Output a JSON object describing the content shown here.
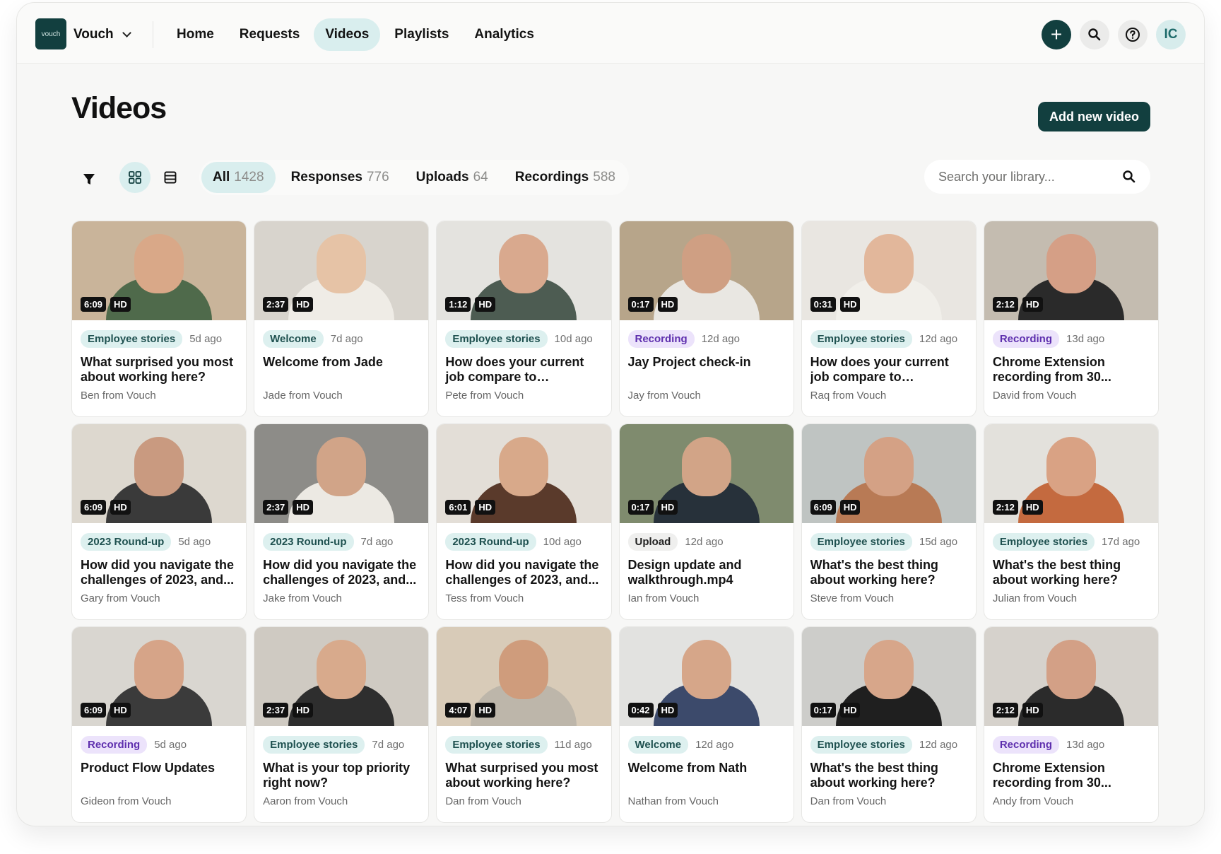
{
  "app": {
    "logo_text": "vouch",
    "brand": "Vouch"
  },
  "nav": [
    "Home",
    "Requests",
    "Videos",
    "Playlists",
    "Analytics"
  ],
  "nav_active": "Videos",
  "toolbar": {
    "avatar_initials": "IC"
  },
  "page": {
    "title": "Videos",
    "add_button": "Add new video"
  },
  "tabs": [
    {
      "label": "All",
      "count": "1428"
    },
    {
      "label": "Responses",
      "count": "776"
    },
    {
      "label": "Uploads",
      "count": "64"
    },
    {
      "label": "Recordings",
      "count": "588"
    }
  ],
  "tab_active": "All",
  "search": {
    "placeholder": "Search your library..."
  },
  "colors": {
    "brand_dark": "#123f3f",
    "accent_light": "#d9eeee",
    "tag_teal": "#ddf0ef",
    "tag_purple": "#ece3fb"
  },
  "cards": [
    {
      "duration": "6:09",
      "quality": "HD",
      "tag": "Employee stories",
      "tag_style": "teal",
      "ago": "5d ago",
      "title": "What surprised you most about working here?",
      "author": "Ben from Vouch",
      "bg": "#c9b49a",
      "skin": "#d9a888",
      "shirt": "#4f6a4b"
    },
    {
      "duration": "2:37",
      "quality": "HD",
      "tag": "Welcome",
      "tag_style": "teal",
      "ago": "7d ago",
      "title": "Welcome from Jade",
      "author": "Jade from Vouch",
      "bg": "#d8d4cd",
      "skin": "#e6c3a6",
      "shirt": "#efece6"
    },
    {
      "duration": "1:12",
      "quality": "HD",
      "tag": "Employee stories",
      "tag_style": "teal",
      "ago": "10d ago",
      "title": "How does your current job compare to previous...",
      "author": "Pete from Vouch",
      "bg": "#e4e3df",
      "skin": "#d9a98e",
      "shirt": "#4d5c52"
    },
    {
      "duration": "0:17",
      "quality": "HD",
      "tag": "Recording",
      "tag_style": "purple",
      "ago": "12d ago",
      "title": "Jay  Project check-in",
      "author": "Jay from Vouch",
      "bg": "#b7a58a",
      "skin": "#cf9f83",
      "shirt": "#e9e7e2"
    },
    {
      "duration": "0:31",
      "quality": "HD",
      "tag": "Employee stories",
      "tag_style": "teal",
      "ago": "12d ago",
      "title": "How does your current job compare to previous...",
      "author": "Raq from Vouch",
      "bg": "#e9e6e1",
      "skin": "#e2b79b",
      "shirt": "#f1efea"
    },
    {
      "duration": "2:12",
      "quality": "HD",
      "tag": "Recording",
      "tag_style": "purple",
      "ago": "13d ago",
      "title": "Chrome Extension recording from 30...",
      "author": "David from Vouch",
      "bg": "#c4bcb0",
      "skin": "#d59f86",
      "shirt": "#2a2a2a"
    },
    {
      "duration": "6:09",
      "quality": "HD",
      "tag": "2023 Round-up",
      "tag_style": "teal",
      "ago": "5d ago",
      "title": "How did you navigate the challenges of 2023, and...",
      "author": "Gary from Vouch",
      "bg": "#ddd8cf",
      "skin": "#c99a80",
      "shirt": "#3a3a3a"
    },
    {
      "duration": "2:37",
      "quality": "HD",
      "tag": "2023 Round-up",
      "tag_style": "teal",
      "ago": "7d ago",
      "title": "How did you navigate the challenges of 2023, and...",
      "author": "Jake from Vouch",
      "bg": "#8d8c88",
      "skin": "#d1a488",
      "shirt": "#ece9e3"
    },
    {
      "duration": "6:01",
      "quality": "HD",
      "tag": "2023 Round-up",
      "tag_style": "teal",
      "ago": "10d ago",
      "title": "How did you navigate the challenges of 2023, and...",
      "author": "Tess from Vouch",
      "bg": "#e3ded7",
      "skin": "#d8a98a",
      "shirt": "#5a3a2b"
    },
    {
      "duration": "0:17",
      "quality": "HD",
      "tag": "Upload",
      "tag_style": "gray",
      "ago": "12d ago",
      "title": "Design update and walkthrough.mp4",
      "author": "Ian from Vouch",
      "bg": "#7f8b6e",
      "skin": "#d2a487",
      "shirt": "#27313a"
    },
    {
      "duration": "6:09",
      "quality": "HD",
      "tag": "Employee stories",
      "tag_style": "teal",
      "ago": "15d ago",
      "title": "What's the best thing about working here?",
      "author": "Steve from Vouch",
      "bg": "#bfc4c2",
      "skin": "#d4a185",
      "shirt": "#b87a55"
    },
    {
      "duration": "2:12",
      "quality": "HD",
      "tag": "Employee stories",
      "tag_style": "teal",
      "ago": "17d ago",
      "title": "What's the best thing about working here?",
      "author": "Julian from Vouch",
      "bg": "#e3e1dc",
      "skin": "#d9a284",
      "shirt": "#c46a3f"
    },
    {
      "duration": "6:09",
      "quality": "HD",
      "tag": "Recording",
      "tag_style": "purple",
      "ago": "5d ago",
      "title": "Product Flow Updates",
      "author": "Gideon from Vouch",
      "bg": "#d9d6d0",
      "skin": "#d6a488",
      "shirt": "#3b3b3b"
    },
    {
      "duration": "2:37",
      "quality": "HD",
      "tag": "Employee stories",
      "tag_style": "teal",
      "ago": "7d ago",
      "title": "What is your top priority right now?",
      "author": "Aaron from Vouch",
      "bg": "#cfcac2",
      "skin": "#d8aa8c",
      "shirt": "#2e2e2e"
    },
    {
      "duration": "4:07",
      "quality": "HD",
      "tag": "Employee stories",
      "tag_style": "teal",
      "ago": "11d ago",
      "title": "What surprised you most about working here?",
      "author": "Dan from Vouch",
      "bg": "#d8cbb8",
      "skin": "#cf9c7c",
      "shirt": "#bdb6aa"
    },
    {
      "duration": "0:42",
      "quality": "HD",
      "tag": "Welcome",
      "tag_style": "teal",
      "ago": "12d ago",
      "title": "Welcome from Nath",
      "author": "Nathan from Vouch",
      "bg": "#e2e2e0",
      "skin": "#d6a689",
      "shirt": "#3c4a6b"
    },
    {
      "duration": "0:17",
      "quality": "HD",
      "tag": "Employee stories",
      "tag_style": "teal",
      "ago": "12d ago",
      "title": "What's the best thing about working here?",
      "author": "Dan from Vouch",
      "bg": "#cdcdca",
      "skin": "#d7a68a",
      "shirt": "#1f1f1f"
    },
    {
      "duration": "2:12",
      "quality": "HD",
      "tag": "Recording",
      "tag_style": "purple",
      "ago": "13d ago",
      "title": "Chrome Extension recording from 30...",
      "author": "Andy from Vouch",
      "bg": "#d6d2cc",
      "skin": "#d3a086",
      "shirt": "#2b2b2b"
    }
  ]
}
